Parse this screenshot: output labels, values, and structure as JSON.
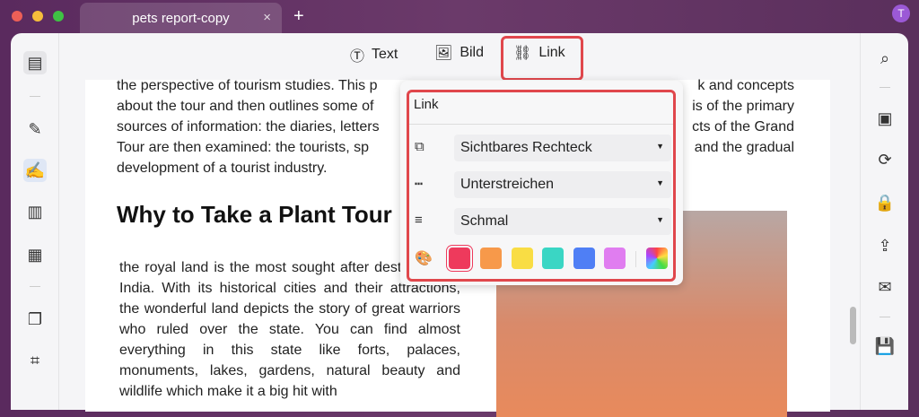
{
  "window": {
    "tab_title": "pets report-copy",
    "close": "×",
    "new_tab": "+",
    "avatar": "T"
  },
  "toolbar": {
    "text": "Text",
    "image": "Bild",
    "link": "Link"
  },
  "document": {
    "intro_lines": [
      "the perspective of tourism studies. This p",
      "about the tour and then outlines some of",
      "sources of information: the diaries, letters",
      "Tour are then examined: the tourists, sp",
      "development of a tourist industry."
    ],
    "intro_right": [
      "k and concepts",
      "is of the primary",
      "cts of the Grand",
      "and the gradual"
    ],
    "heading": "Why to Take a Plant Tour",
    "body": "the royal land is the most sought after destination in India. With its historical cities and their attractions, the wonderful land depicts the story of great warriors who ruled over the state. You can find almost everything in this state like forts, palaces, monuments, lakes, gardens, natural beauty and wildlife which make it a big hit with"
  },
  "link_panel": {
    "title": "Link",
    "rect_type": "Sichtbares Rechteck",
    "line_style": "Unterstreichen",
    "thickness": "Schmal",
    "colors": [
      "#ee3a5c",
      "#f7994a",
      "#f9dd44",
      "#3ad6c4",
      "#4f7ff5",
      "#e07df0"
    ]
  }
}
